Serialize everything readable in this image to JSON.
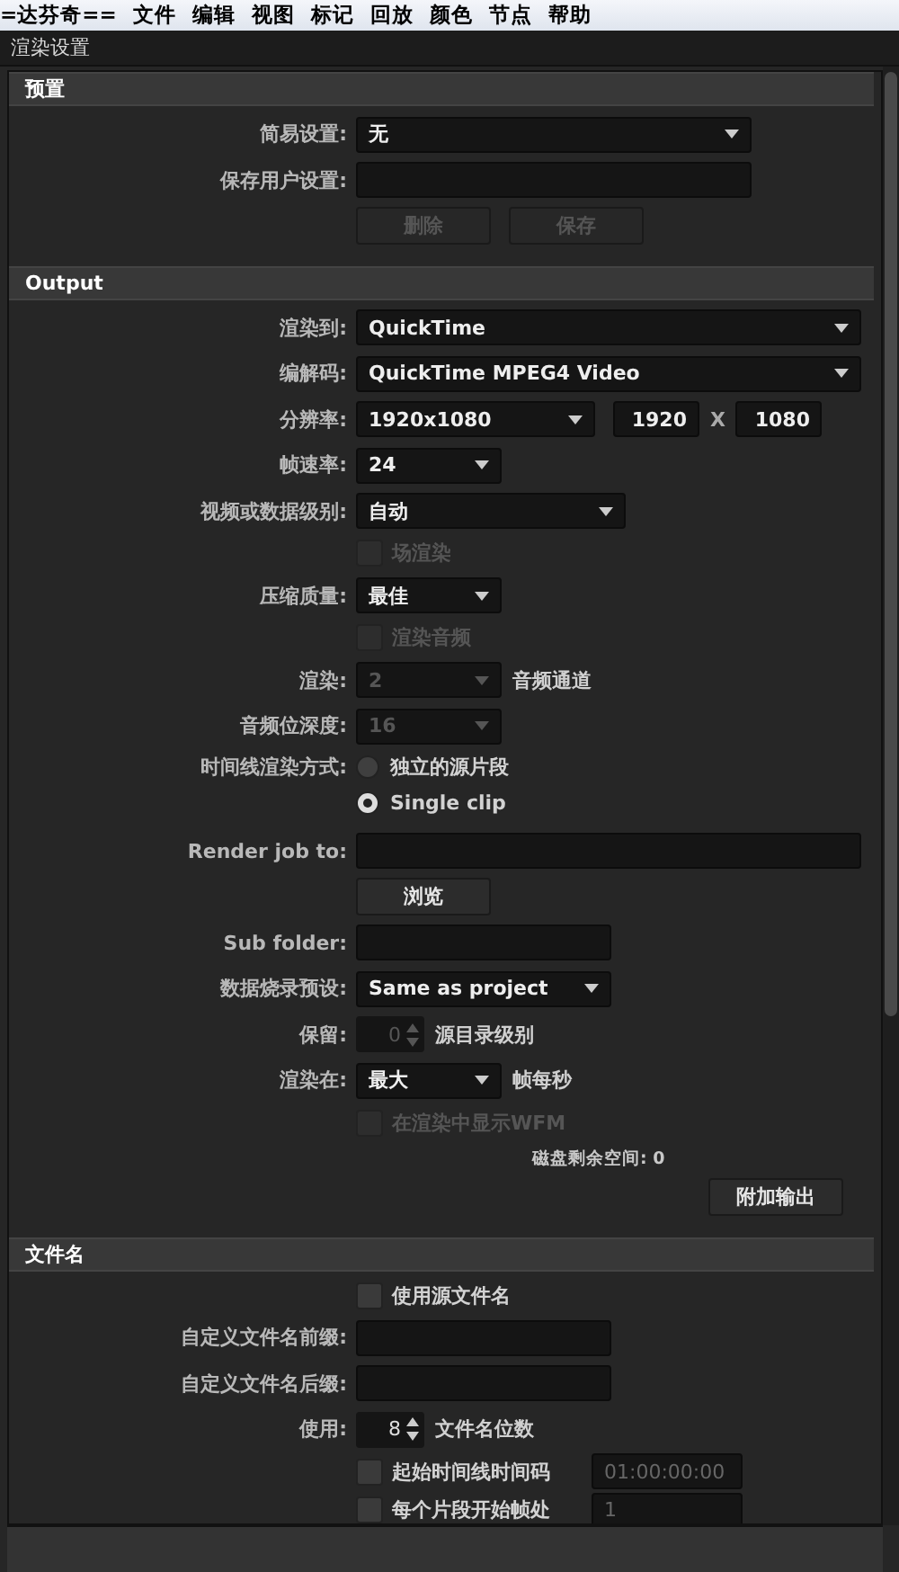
{
  "menu_bar": {
    "items": [
      "=达芬奇==",
      "文件",
      "编辑",
      "视图",
      "标记",
      "回放",
      "颜色",
      "节点",
      "帮助"
    ]
  },
  "panel": {
    "title": "渲染设置"
  },
  "sections": [
    {
      "title": "预置",
      "rows": [
        {
          "kind": "dropdown",
          "label": "简易设置:",
          "value": "无",
          "disabled": false
        },
        {
          "kind": "field",
          "label": "保存用户设置:"
        },
        {
          "kind": "buttons",
          "buttons": [
            {
              "label": "删除",
              "disabled": true
            },
            {
              "label": "保存",
              "disabled": true
            }
          ]
        }
      ]
    },
    {
      "title": "Output",
      "rows": [
        {
          "kind": "dropdown",
          "label": "渲染到:",
          "value": "QuickTime",
          "disabled": false
        },
        {
          "kind": "dropdown",
          "label": "编解码:",
          "value": "QuickTime MPEG4 Video",
          "disabled": false
        },
        {
          "kind": "resolution",
          "label": "分辨率:",
          "value": "1920x1080",
          "width_value": "1920",
          "separator": "X",
          "height_value": "1080"
        },
        {
          "kind": "dropdown",
          "label": "帧速率:",
          "value": "24",
          "disabled": false
        },
        {
          "kind": "dropdown",
          "label": "视频或数据级别:",
          "value": "自动",
          "disabled": false
        },
        {
          "kind": "checkbox",
          "text": "场渲染",
          "checked": false,
          "disabled": true
        },
        {
          "kind": "dropdown",
          "label": "压缩质量:",
          "value": "最佳",
          "disabled": false
        },
        {
          "kind": "checkbox",
          "text": "渲染音频",
          "checked": false,
          "disabled": true
        },
        {
          "kind": "dropdown",
          "label": "渲染:",
          "value": "2",
          "disabled": true,
          "suffix": "音频通道"
        },
        {
          "kind": "dropdown",
          "label": "音频位深度:",
          "value": "16",
          "disabled": true
        },
        {
          "kind": "radio_group",
          "label": "时间线渲染方式:",
          "options": [
            {
              "label": "独立的源片段",
              "selected": false
            },
            {
              "label": "Single clip",
              "selected": true
            }
          ]
        },
        {
          "kind": "field",
          "label": "Render job to:"
        },
        {
          "kind": "buttons",
          "buttons": [
            {
              "label": "浏览",
              "disabled": false
            }
          ]
        },
        {
          "kind": "field",
          "label": "Sub folder:"
        },
        {
          "kind": "dropdown",
          "label": "数据烧录预设:",
          "value": "Same as project",
          "disabled": false
        },
        {
          "kind": "spinner",
          "label": "保留:",
          "value": "0",
          "disabled": true,
          "suffix": "源目录级别"
        },
        {
          "kind": "dropdown",
          "label": "渲染在:",
          "value": "最大",
          "disabled": false,
          "suffix": "帧每秒"
        },
        {
          "kind": "checkbox",
          "text": "在渲染中显示WFM",
          "checked": false,
          "disabled": true
        },
        {
          "kind": "info",
          "text": "磁盘剩余空间: 0"
        },
        {
          "kind": "buttons",
          "buttons": [
            {
              "label": "附加输出",
              "disabled": false
            }
          ]
        }
      ]
    },
    {
      "title": "文件名",
      "rows": [
        {
          "kind": "checkbox",
          "text": "使用源文件名",
          "checked": false,
          "disabled": false
        },
        {
          "kind": "field",
          "label": "自定义文件名前缀:"
        },
        {
          "kind": "field",
          "label": "自定义文件名后缀:"
        },
        {
          "kind": "spinner",
          "label": "使用:",
          "value": "8",
          "disabled": false,
          "suffix": "文件名位数"
        },
        {
          "kind": "checkbox",
          "text": "起始时间线时间码",
          "checked": false,
          "disabled": false,
          "field_value": "01:00:00:00"
        },
        {
          "kind": "checkbox",
          "text": "每个片段开始帧处",
          "checked": false,
          "disabled": false,
          "field_value": "1"
        }
      ]
    }
  ]
}
